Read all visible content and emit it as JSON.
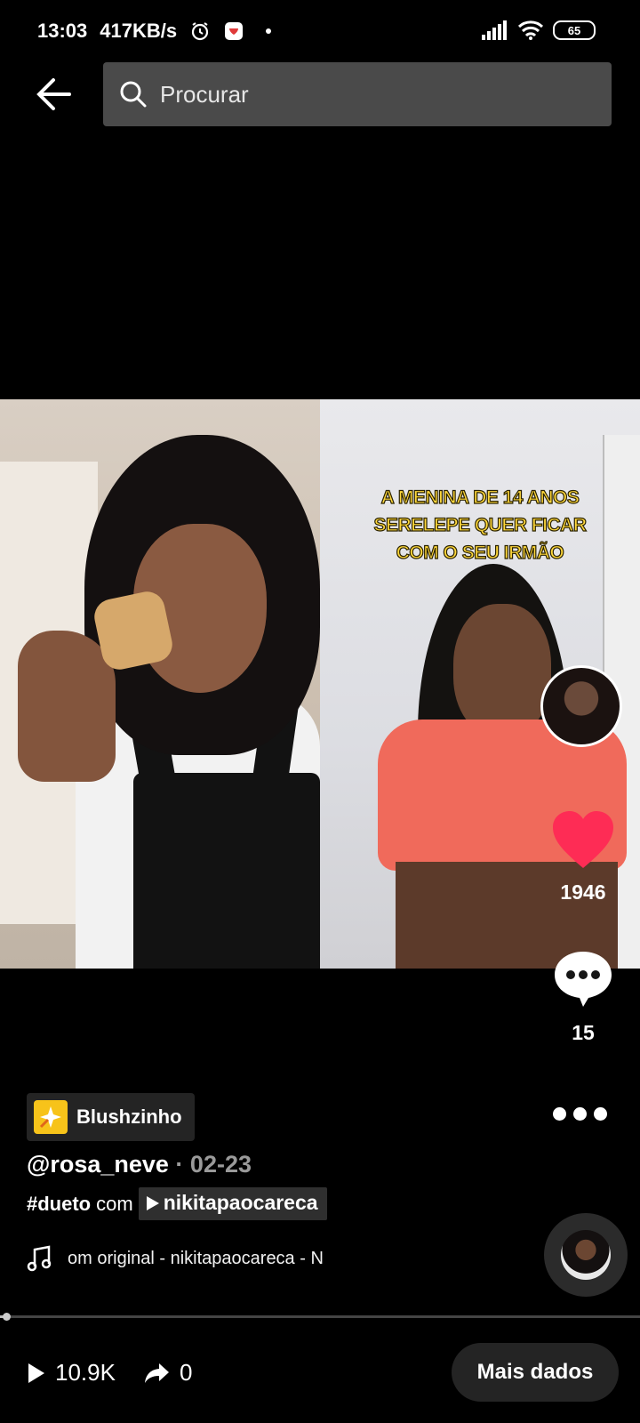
{
  "status_bar": {
    "time": "13:03",
    "network_speed": "417KB/s",
    "battery": "65",
    "icons": [
      "alarm-icon",
      "app-notification-icon",
      "dot-icon",
      "signal-icon",
      "wifi-icon",
      "battery-icon"
    ]
  },
  "search": {
    "placeholder": "Procurar"
  },
  "video": {
    "caption_lines": [
      "A MENINA DE 14 ANOS",
      "SERELEPE QUER FICAR",
      "COM O SEU IRMÃO"
    ]
  },
  "actions": {
    "likes": "1946",
    "comments": "15",
    "like_color": "#fe2c55"
  },
  "effect": {
    "label": "Blushzinho",
    "icon_color": "#f7c31a"
  },
  "post": {
    "author": "@rosa_neve",
    "separator": " · ",
    "date": "02-23",
    "duet_tag": "#dueto",
    "duet_with": "com",
    "duet_user": "nikitapaocareca",
    "music": "om original - nikitapaocareca - N"
  },
  "stats": {
    "views": "10.9K",
    "shares": "0",
    "more_data": "Mais dados"
  }
}
